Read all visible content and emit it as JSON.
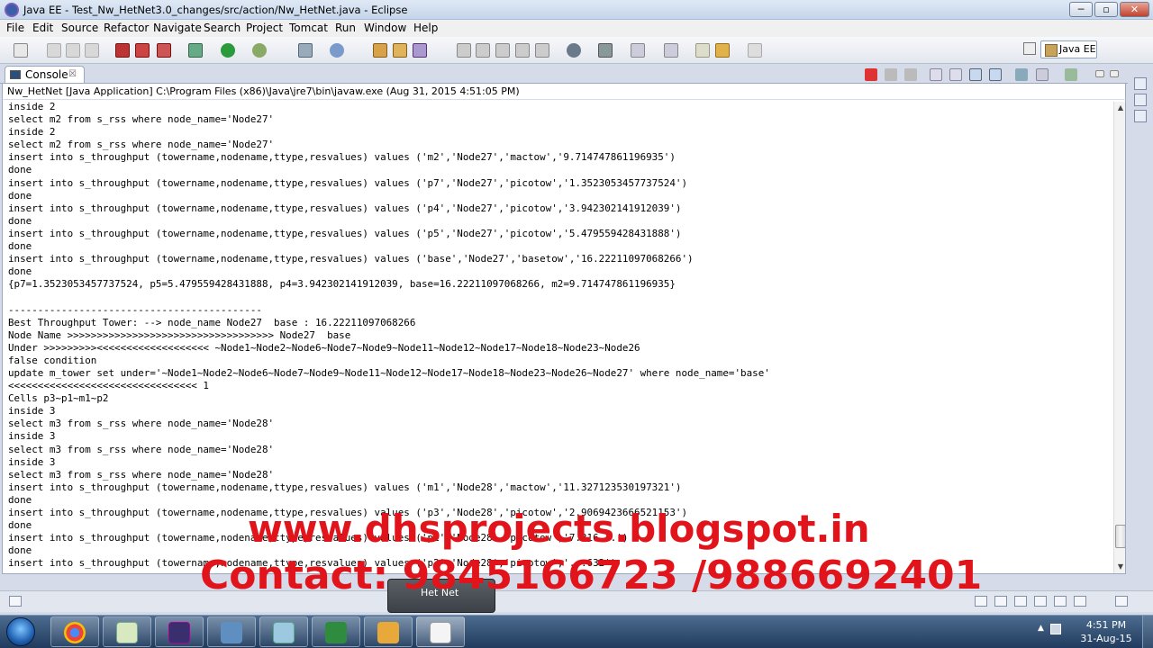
{
  "window": {
    "title": "Java EE - Test_Nw_HetNet3.0_changes/src/action/Nw_HetNet.java - Eclipse",
    "minimize": "─",
    "maximize": "▫",
    "close": "✕"
  },
  "menu": [
    "File",
    "Edit",
    "Source",
    "Refactor",
    "Navigate",
    "Search",
    "Project",
    "Tomcat",
    "Run",
    "Window",
    "Help"
  ],
  "perspective": {
    "label": "Java EE"
  },
  "console_view": {
    "tab_label": "Console",
    "tab_close": "☒",
    "launch_line": "Nw_HetNet [Java Application] C:\\Program Files (x86)\\Java\\jre7\\bin\\javaw.exe (Aug 31, 2015 4:51:05 PM)",
    "lines": [
      "inside 2",
      "select m2 from s_rss where node_name='Node27'",
      "inside 2",
      "select m2 from s_rss where node_name='Node27'",
      "insert into s_throughput (towername,nodename,ttype,resvalues) values ('m2','Node27','mactow','9.714747861196935')",
      "done",
      "insert into s_throughput (towername,nodename,ttype,resvalues) values ('p7','Node27','picotow','1.3523053457737524')",
      "done",
      "insert into s_throughput (towername,nodename,ttype,resvalues) values ('p4','Node27','picotow','3.942302141912039')",
      "done",
      "insert into s_throughput (towername,nodename,ttype,resvalues) values ('p5','Node27','picotow','5.479559428431888')",
      "done",
      "insert into s_throughput (towername,nodename,ttype,resvalues) values ('base','Node27','basetow','16.22211097068266')",
      "done",
      "{p7=1.3523053457737524, p5=5.479559428431888, p4=3.942302141912039, base=16.22211097068266, m2=9.714747861196935}",
      "",
      "-------------------------------------------",
      "Best Throughput Tower: --> node_name Node27  base : 16.22211097068266",
      "Node Name >>>>>>>>>>>>>>>>>>>>>>>>>>>>>>>>>>> Node27  base",
      "Under >>>>>>>>><<<<<<<<<<<<<<<<<<< ~Node1~Node2~Node6~Node7~Node9~Node11~Node12~Node17~Node18~Node23~Node26",
      "false condition",
      "update m_tower set under='~Node1~Node2~Node6~Node7~Node9~Node11~Node12~Node17~Node18~Node23~Node26~Node27' where node_name='base'",
      "<<<<<<<<<<<<<<<<<<<<<<<<<<<<<<<< 1",
      "Cells p3~p1~m1~p2",
      "inside 3",
      "select m3 from s_rss where node_name='Node28'",
      "inside 3",
      "select m3 from s_rss where node_name='Node28'",
      "inside 3",
      "select m3 from s_rss where node_name='Node28'",
      "insert into s_throughput (towername,nodename,ttype,resvalues) values ('m1','Node28','mactow','11.327123530197321')",
      "done",
      "insert into s_throughput (towername,nodename,ttype,resvalues) values ('p3','Node28','picotow','2.9069423666521153')",
      "done",
      "insert into s_throughput (towername,nodename,ttype,resvalues) values ('p1','Node28','picotow','7.316...')",
      "done",
      "insert into s_throughput (towername,nodename,ttype,resvalues) values ('p2','Node28','picotow','...632')"
    ]
  },
  "tooltip": {
    "label": "Het Net"
  },
  "watermark": {
    "line1": "www.dhsprojects.blogspot.in",
    "line2": "Contact: 9845166723 /9886692401"
  },
  "taskbar": {
    "clock_time": "4:51 PM",
    "clock_date": "31-Aug-15"
  },
  "colors": {
    "watermark": "#e0141a",
    "console_bg": "#ffffff",
    "taskbar": "#2a4a70"
  }
}
